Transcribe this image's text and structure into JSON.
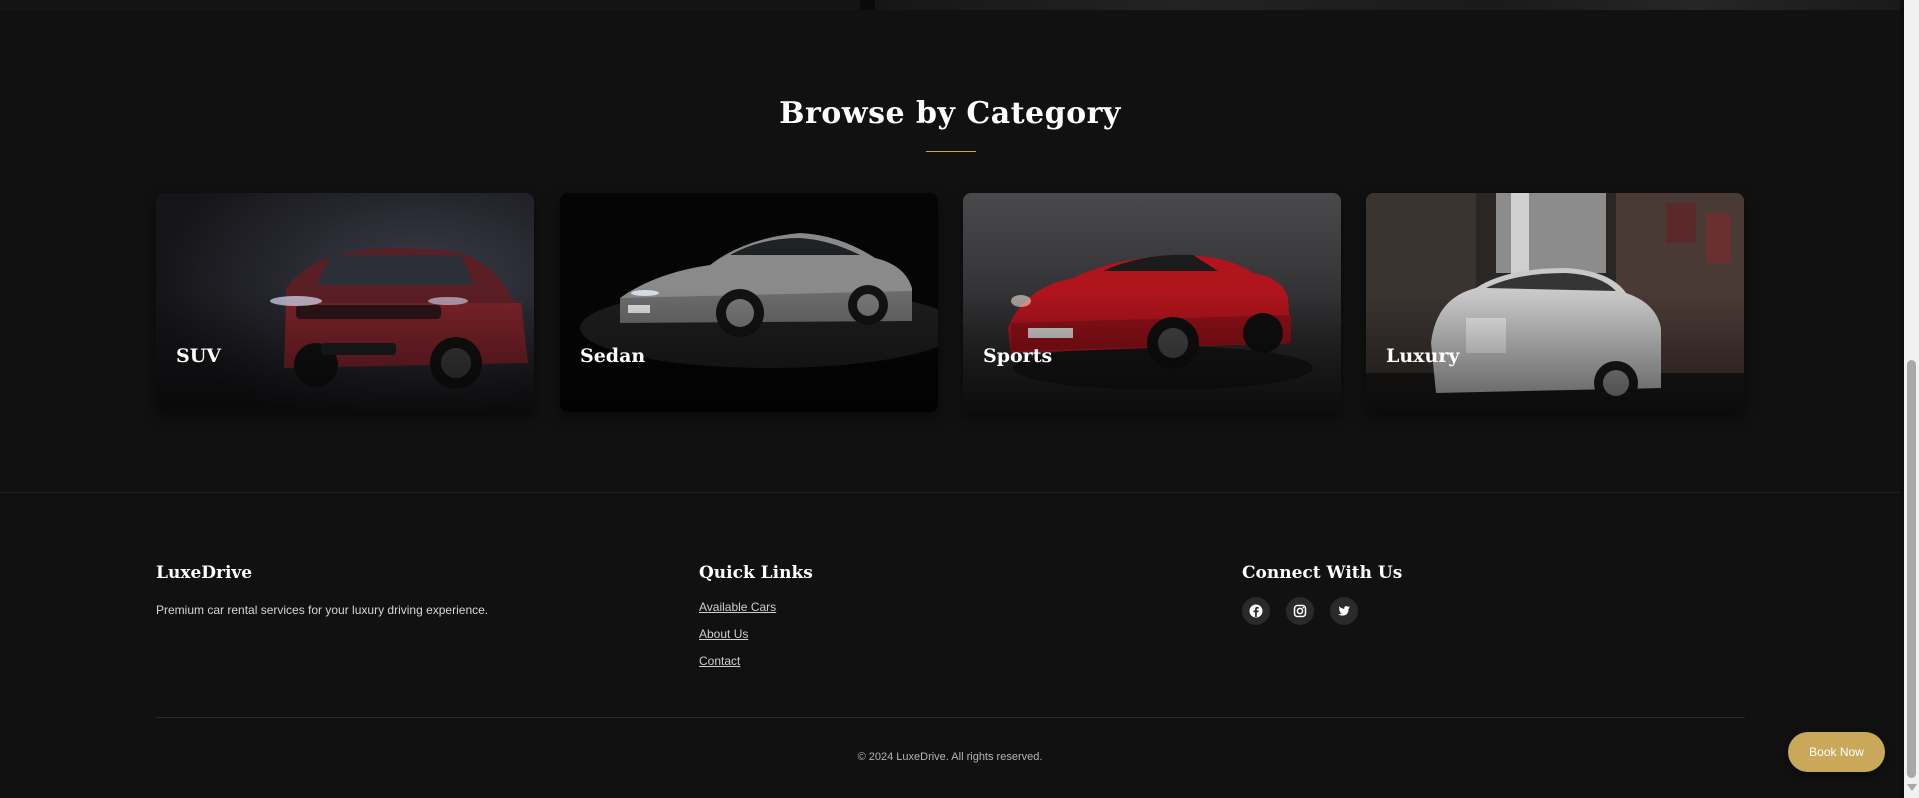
{
  "section": {
    "title": "Browse by Category"
  },
  "categories": [
    {
      "label": "SUV"
    },
    {
      "label": "Sedan"
    },
    {
      "label": "Sports"
    },
    {
      "label": "Luxury"
    }
  ],
  "footer": {
    "brand": {
      "heading": "LuxeDrive",
      "text": "Premium car rental services for your luxury driving experience."
    },
    "quick_links": {
      "heading": "Quick Links",
      "items": [
        "Available Cars",
        "About Us",
        "Contact"
      ]
    },
    "connect": {
      "heading": "Connect With Us",
      "icons": [
        "facebook-icon",
        "instagram-icon",
        "twitter-icon"
      ]
    },
    "copyright": "© 2024 LuxeDrive. All rights reserved."
  },
  "book_now": "Book Now",
  "colors": {
    "accent": "#c9a959",
    "background": "#111111"
  }
}
